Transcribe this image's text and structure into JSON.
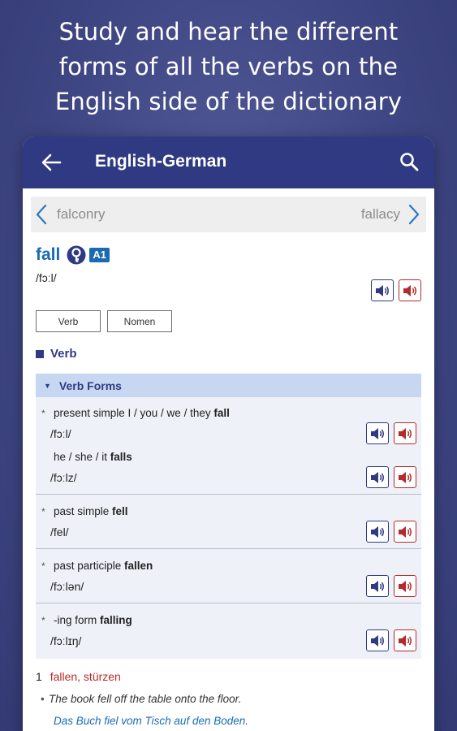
{
  "promo": {
    "line1": "Study and hear the different",
    "line2": "forms of all the verbs on the",
    "line3": "English side of the dictionary"
  },
  "appbar": {
    "title": "English-German"
  },
  "nav": {
    "prev": "falconry",
    "next": "fallacy"
  },
  "entry": {
    "headword": "fall",
    "level": "A1",
    "pronunciation": "/fɔːl/",
    "tabs": [
      "Verb",
      "Nomen"
    ],
    "section": "Verb",
    "forms_header": "Verb Forms",
    "forms": [
      {
        "lines": [
          {
            "label": "present simple I / you / we / they ",
            "bold": "fall",
            "pron": "/fɔːl/"
          },
          {
            "label": "he / she / it ",
            "bold": "falls",
            "pron": "/fɔːlz/"
          }
        ]
      },
      {
        "lines": [
          {
            "label": "past simple ",
            "bold": "fell",
            "pron": "/fel/"
          }
        ]
      },
      {
        "lines": [
          {
            "label": "past participle ",
            "bold": "fallen",
            "pron": "/fɔːlən/"
          }
        ]
      },
      {
        "lines": [
          {
            "label": "-ing form ",
            "bold": "falling",
            "pron": "/fɔːlɪŋ/"
          }
        ]
      }
    ],
    "sense_number": "1",
    "sense_translation": "fallen, stürzen",
    "example": "The book fell off the table onto the floor.",
    "example_translation": "Das Buch fiel vom Tisch auf den Boden."
  },
  "colors": {
    "appbar": "#2f3a82",
    "link": "#1a6bb3",
    "us_audio": "#b52a2a",
    "forms_header": "#c7d7f1"
  }
}
